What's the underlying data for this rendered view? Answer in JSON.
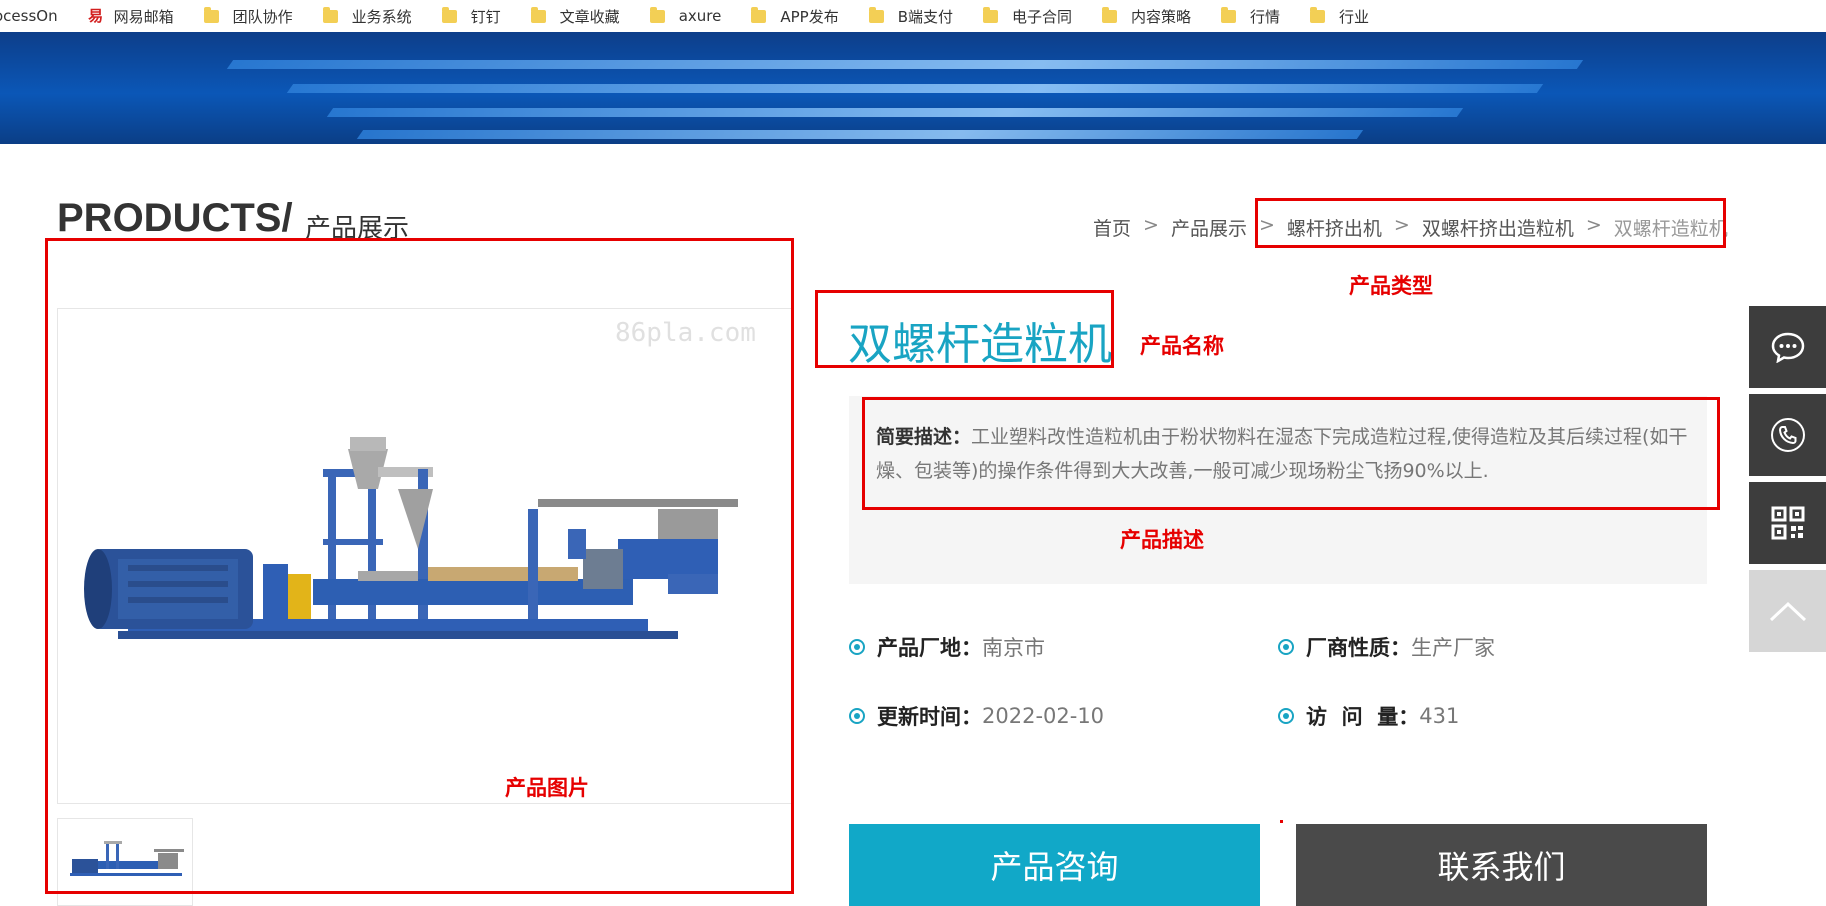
{
  "bookmarks": [
    {
      "label": "ocessOn",
      "icon": "none"
    },
    {
      "label": "网易邮箱",
      "icon": "mail-163-icon"
    },
    {
      "label": "团队协作",
      "icon": "folder-icon"
    },
    {
      "label": "业务系统",
      "icon": "folder-icon"
    },
    {
      "label": "钉钉",
      "icon": "folder-icon"
    },
    {
      "label": "文章收藏",
      "icon": "folder-icon"
    },
    {
      "label": "axure",
      "icon": "folder-icon"
    },
    {
      "label": "APP发布",
      "icon": "folder-icon"
    },
    {
      "label": "B端支付",
      "icon": "folder-icon"
    },
    {
      "label": "电子合同",
      "icon": "folder-icon"
    },
    {
      "label": "内容策略",
      "icon": "folder-icon"
    },
    {
      "label": "行情",
      "icon": "folder-icon"
    },
    {
      "label": "行业",
      "icon": "folder-icon"
    }
  ],
  "heading": {
    "main": "PRODUCTS/",
    "sub": "产品展示"
  },
  "breadcrumb": {
    "items": [
      "首页",
      "产品展示",
      "螺杆挤出机",
      "双螺杆挤出造粒机",
      "双螺杆造粒机"
    ],
    "separator": ">"
  },
  "product": {
    "name": "双螺杆造粒机",
    "watermark": "86pla.com",
    "desc_label": "简要描述：",
    "desc_text": "工业塑料改性造粒机由于粉状物料在湿态下完成造粒过程,使得造粒及其后续过程(如干燥、包装等)的操作条件得到大大改善,一般可减少现场粉尘飞扬90%以上.",
    "attributes": [
      {
        "key": "产品厂地：",
        "value": "南京市"
      },
      {
        "key": "厂商性质：",
        "value": "生产厂家"
      },
      {
        "key": "更新时间：",
        "value": "2022-02-10"
      },
      {
        "key": "访  问  量：",
        "value": "431"
      }
    ]
  },
  "annotations": {
    "type": "产品类型",
    "name": "产品名称",
    "desc": "产品描述",
    "image": "产品图片"
  },
  "buttons": {
    "consult": "产品咨询",
    "contact": "联系我们"
  },
  "side_bar": [
    "chat-icon",
    "phone-icon",
    "qrcode-icon",
    "back-to-top-icon"
  ],
  "colors": {
    "accent": "#19a4c3",
    "button_primary": "#11a8c8",
    "button_secondary": "#4a4a4a",
    "annotation": "#e60000"
  }
}
